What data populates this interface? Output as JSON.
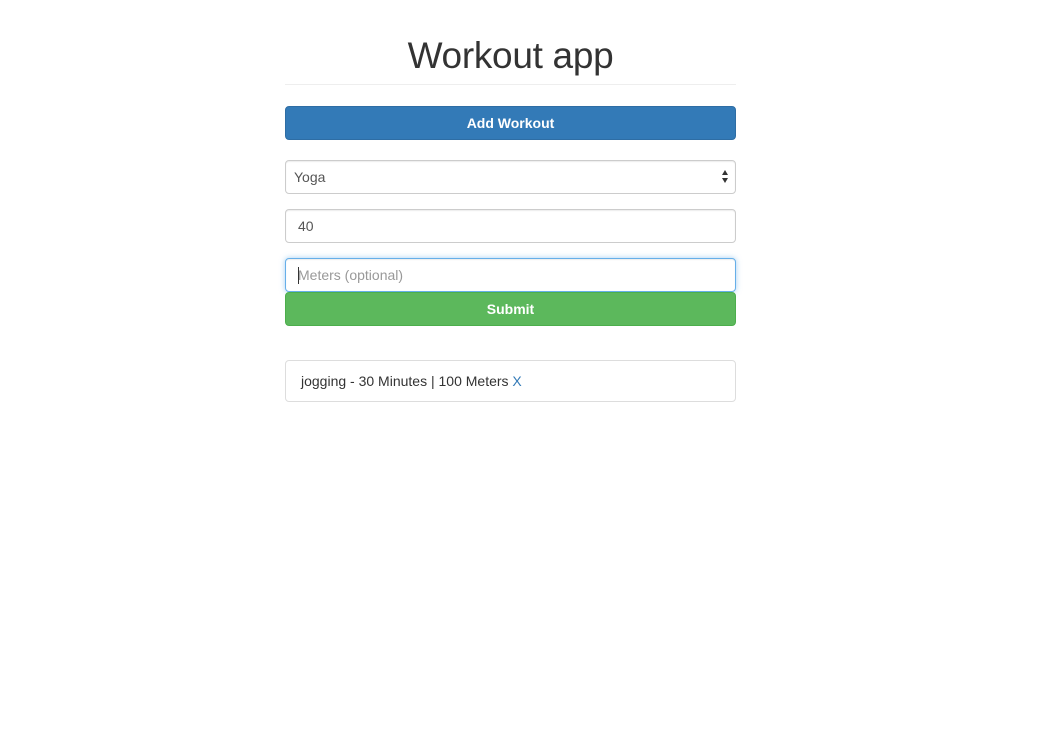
{
  "header": {
    "title": "Workout app"
  },
  "add_workout_button": {
    "label": "Add Workout"
  },
  "form": {
    "type_select": {
      "selected": "Yoga"
    },
    "minutes_input": {
      "value": "40"
    },
    "meters_input": {
      "value": "",
      "placeholder": "Meters (optional)"
    },
    "submit_label": "Submit"
  },
  "workouts": [
    {
      "text": "jogging - 30 Minutes | 100 Meters",
      "delete_label": "X"
    }
  ],
  "colors": {
    "primary": "#337ab7",
    "success": "#5cb85c",
    "link": "#337ab7"
  }
}
